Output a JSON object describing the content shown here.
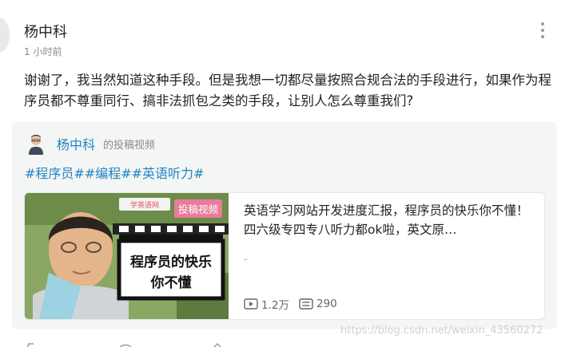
{
  "comment": {
    "author": "杨中科",
    "time": "1 小时前",
    "text": "谢谢了，我当然知道这种手段。但是我想一切都尽量按照合规合法的手段进行，如果作为程序员都不尊重同行、搞非法抓包之类的手段，让别人怎么尊重我们?"
  },
  "share": {
    "author": "杨中科",
    "source_label": "的投稿视频",
    "tags": "#程序员##编程##英语听力#",
    "video": {
      "badge": "投稿视频",
      "thumb_logo": "学英语网",
      "thumb_line1": "程序员的快乐",
      "thumb_line2": "你不懂",
      "title": "英语学习网站开发进度汇报，程序员的快乐你不懂！四六级专四专八听力都ok啦，英文原…",
      "dash": "-",
      "plays": "1.2万",
      "comments": "290"
    }
  },
  "watermark": "https://blog.csdn.net/weixin_43560272",
  "icons": [
    "more-vertical-icon",
    "play-icon",
    "comment-icon"
  ]
}
